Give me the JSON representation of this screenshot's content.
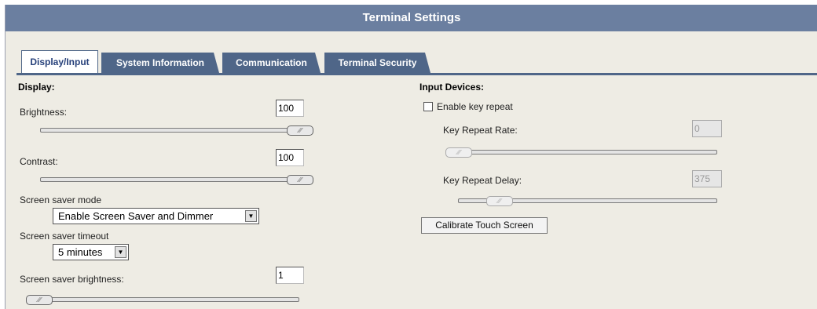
{
  "title": "Terminal Settings",
  "tabs": [
    {
      "label": "Display/Input",
      "active": true
    },
    {
      "label": "System Information",
      "active": false
    },
    {
      "label": "Communication",
      "active": false
    },
    {
      "label": "Terminal Security",
      "active": false
    }
  ],
  "display": {
    "header": "Display:",
    "brightness_label": "Brightness:",
    "brightness_value": "100",
    "brightness_level": 1.0,
    "contrast_label": "Contrast:",
    "contrast_value": "100",
    "contrast_level": 1.0,
    "saver_mode_label": "Screen saver mode",
    "saver_mode_value": "Enable Screen Saver and Dimmer",
    "saver_timeout_label": "Screen saver timeout",
    "saver_timeout_value": "5 minutes",
    "saver_brightness_label": "Screen saver brightness:",
    "saver_brightness_value": "1",
    "saver_brightness_level": 0.0
  },
  "input": {
    "header": "Input Devices:",
    "key_repeat_label": "Enable key repeat",
    "key_repeat_checked": false,
    "rate_label": "Key Repeat Rate:",
    "rate_value": "0",
    "rate_level": 0.0,
    "delay_label": "Key Repeat Delay:",
    "delay_value": "375",
    "delay_level": 0.12,
    "calibrate_label": "Calibrate Touch Screen"
  },
  "icons": {
    "thumb_grip": "slider-grip-icon",
    "dropdown": "chevron-down-icon"
  },
  "colors": {
    "titlebar": "#6b7fa0",
    "tab": "#4f6688",
    "panel": "#eeece4"
  }
}
